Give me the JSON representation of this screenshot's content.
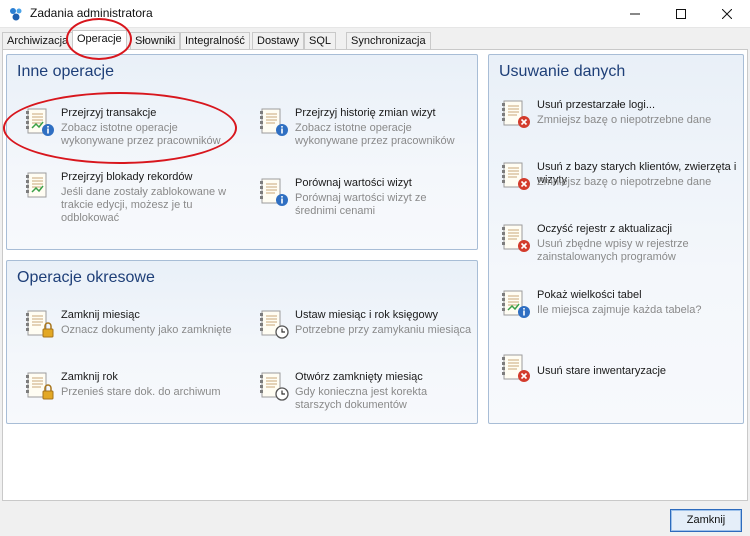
{
  "window": {
    "title": "Zadania administratora"
  },
  "tabs": [
    {
      "label": "Archiwizacja"
    },
    {
      "label": "Operacje"
    },
    {
      "label": "Słowniki"
    },
    {
      "label": "Integralność"
    },
    {
      "label": "Dostawy"
    },
    {
      "label": "SQL"
    },
    {
      "label": "Synchronizacja"
    }
  ],
  "inne": {
    "title": "Inne operacje",
    "ops": [
      {
        "title": "Przejrzyj transakcje",
        "desc": "Zobacz istotne operacje wykonywane przez pracowników",
        "icon": "document-info-icon"
      },
      {
        "title": "Przejrzyj historię zmian wizyt",
        "desc": "Zobacz istotne operacje wykonywane przez pracowników",
        "icon": "document-info-icon"
      },
      {
        "title": "Przejrzyj blokady rekordów",
        "desc": "Jeśli dane zostały zablokowane w trakcie edycji, możesz je tu odblokować",
        "icon": "document-chart-icon"
      },
      {
        "title": "Porównaj wartości wizyt",
        "desc": "Porównaj wartości wizyt ze średnimi cenami",
        "icon": "document-info-icon"
      }
    ]
  },
  "okresowe": {
    "title": "Operacje okresowe",
    "ops": [
      {
        "title": "Zamknij miesiąc",
        "desc": "Oznacz dokumenty jako zamknięte",
        "icon": "document-lock-icon"
      },
      {
        "title": "Ustaw miesiąc i rok księgowy",
        "desc": "Potrzebne przy zamykaniu miesiąca",
        "icon": "document-clock-icon"
      },
      {
        "title": "Zamknij rok",
        "desc": "Przenieś stare dok. do archiwum",
        "icon": "document-lock-icon"
      },
      {
        "title": "Otwórz zamknięty miesiąc",
        "desc": "Gdy konieczna jest korekta starszych dokumentów",
        "icon": "document-clock-icon"
      }
    ]
  },
  "usuwanie": {
    "title": "Usuwanie danych",
    "ops": [
      {
        "title": "Usuń przestarzałe logi...",
        "desc": "Zmniejsz bazę o niepotrzebne dane",
        "icon": "document-delete-icon"
      },
      {
        "title": "Usuń z bazy starych klientów, zwierzęta i wizyty",
        "desc": "Zmniejsz bazę o niepotrzebne dane",
        "icon": "document-delete-icon"
      },
      {
        "title": "Oczyść rejestr z aktualizacji",
        "desc": "Usuń zbędne wpisy w rejestrze zainstalowanych programów",
        "icon": "document-delete-icon"
      },
      {
        "title": "Pokaż wielkości tabel",
        "desc": "Ile miejsca zajmuje każda tabela?",
        "icon": "document-info-icon"
      },
      {
        "title": "Usuń stare inwentaryzacje",
        "desc": "",
        "icon": "document-delete-icon"
      }
    ]
  },
  "footer": {
    "close_label": "Zamknij"
  }
}
